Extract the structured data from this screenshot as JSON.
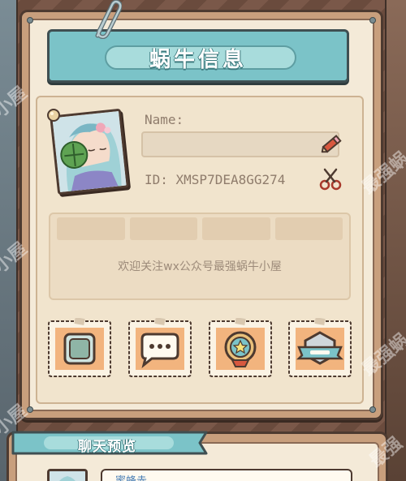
{
  "title": "蜗牛信息",
  "profile": {
    "name_label": "Name:",
    "name_value": "",
    "id_text": "ID: XMSP7DEA8GG274"
  },
  "notice": {
    "tabs": [
      "",
      "",
      "",
      ""
    ],
    "message": "欢迎关注wx公众号最强蜗牛小屋"
  },
  "stamps": [
    {
      "icon": "frame-icon"
    },
    {
      "icon": "chat-bubble-icon"
    },
    {
      "icon": "star-badge-icon"
    },
    {
      "icon": "banner-badge-icon"
    }
  ],
  "chat_preview": {
    "title": "聊天预览",
    "sender_name": "蜜蜂赤"
  },
  "watermarks": [
    "小屋",
    "最强蜗",
    "小屋",
    "最强蜗",
    "小屋",
    "最强"
  ],
  "colors": {
    "teal_banner": "#7bc3c8",
    "panel_paper": "#f4ead8",
    "frame_brown": "#4d3a30",
    "stamp_orange": "#f2b47e"
  }
}
